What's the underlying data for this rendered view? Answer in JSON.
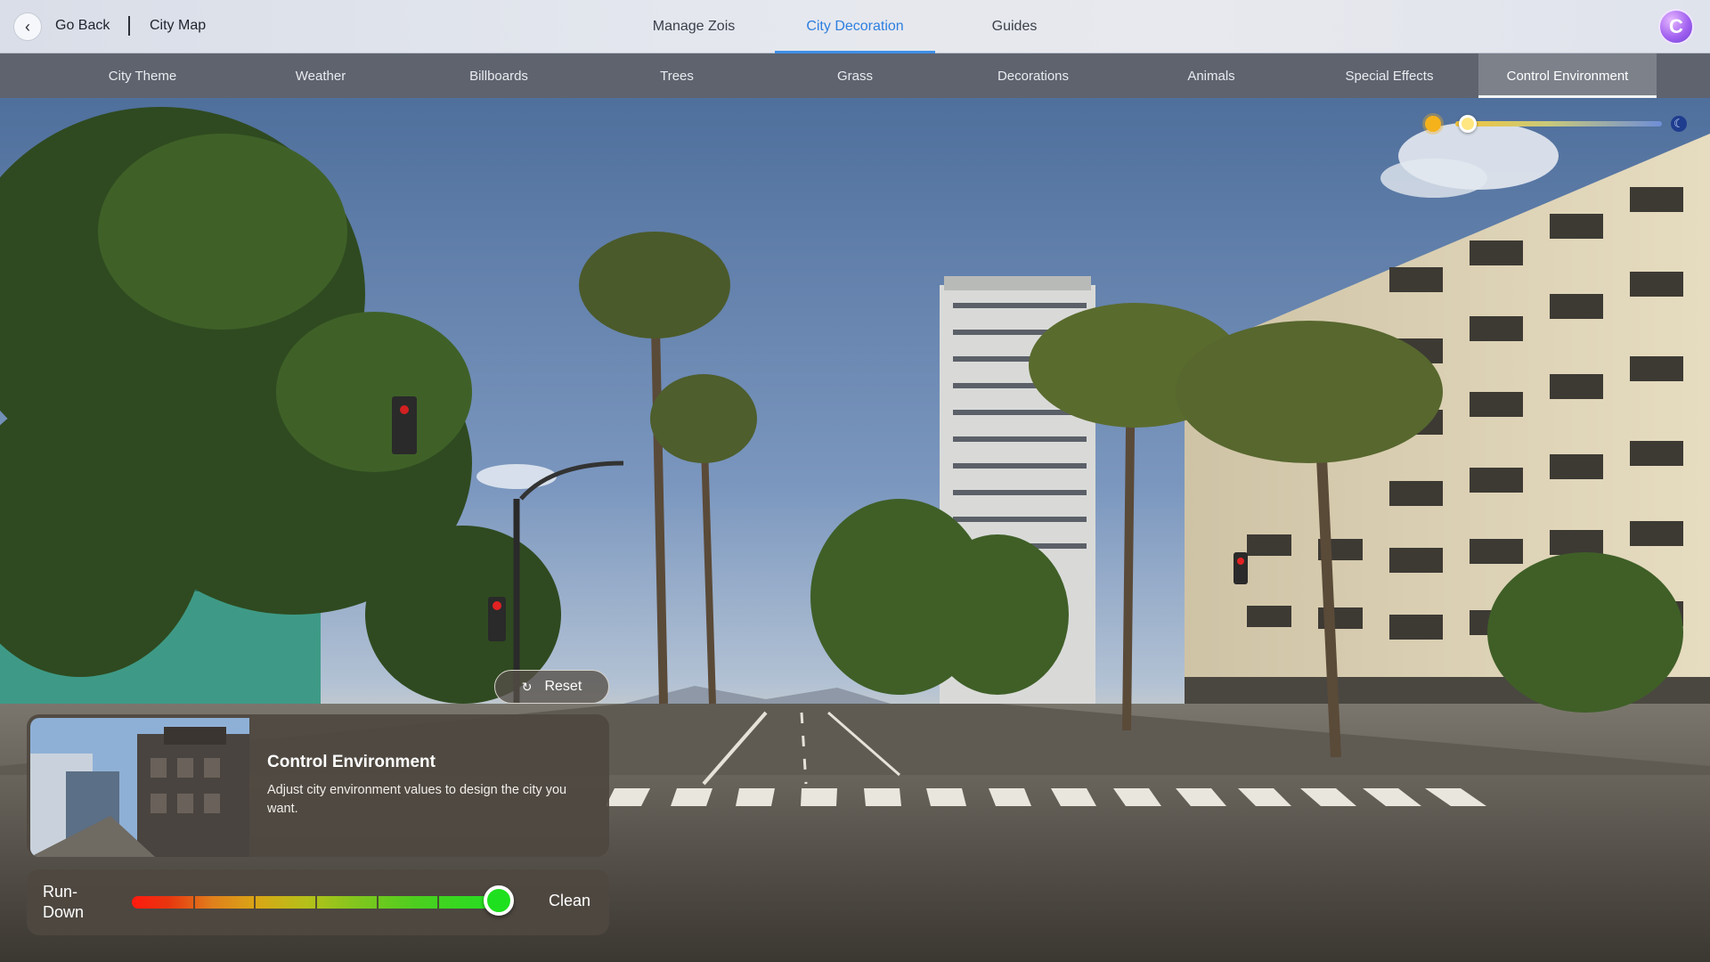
{
  "header": {
    "back_label": "Go Back",
    "breadcrumb": "City Map",
    "tabs": [
      {
        "label": "Manage Zois",
        "active": false
      },
      {
        "label": "City Decoration",
        "active": true
      },
      {
        "label": "Guides",
        "active": false
      }
    ],
    "avatar_letter": "C",
    "accent_color": "#2d7fe0"
  },
  "subnav": {
    "tabs": [
      {
        "label": "City Theme",
        "active": false
      },
      {
        "label": "Weather",
        "active": false
      },
      {
        "label": "Billboards",
        "active": false
      },
      {
        "label": "Trees",
        "active": false
      },
      {
        "label": "Grass",
        "active": false
      },
      {
        "label": "Decorations",
        "active": false
      },
      {
        "label": "Animals",
        "active": false
      },
      {
        "label": "Special Effects",
        "active": false
      },
      {
        "label": "Control Environment",
        "active": true
      }
    ]
  },
  "time_of_day": {
    "start_icon": "sun-icon",
    "end_icon": "moon-icon",
    "value": 0.02
  },
  "reset": {
    "label": "Reset",
    "icon": "refresh-icon"
  },
  "info": {
    "title": "Control Environment",
    "description": "Adjust city environment values to design the city you want."
  },
  "cleanliness": {
    "left_label": "Run-Down",
    "right_label": "Clean",
    "value": 1.0,
    "segments": 5,
    "colors": [
      "#ff1a0f",
      "#e0801c",
      "#b4c11a",
      "#4bcf1f",
      "#22e022"
    ]
  }
}
